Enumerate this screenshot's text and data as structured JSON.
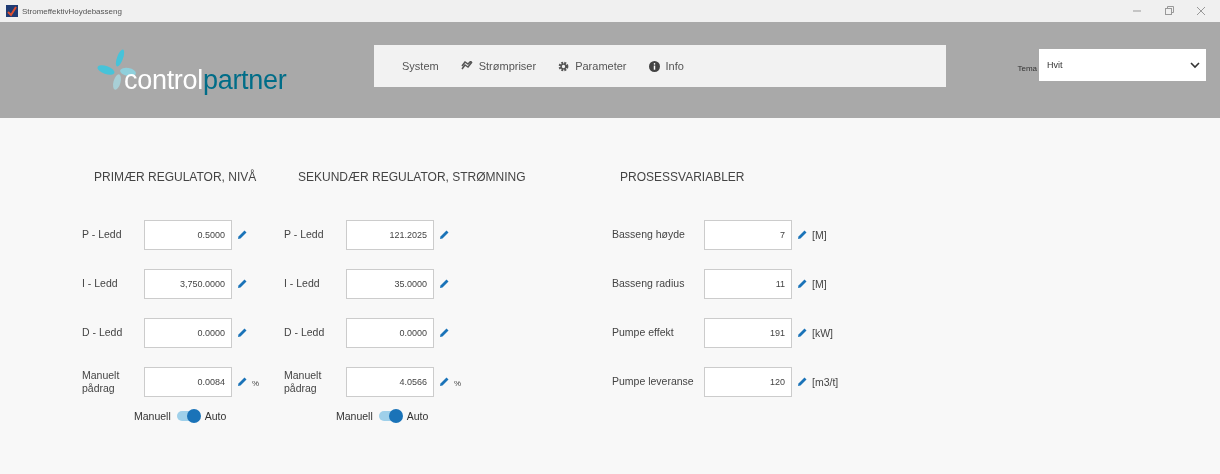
{
  "window": {
    "title": "StromeffektivHoydebasseng"
  },
  "logo": {
    "first": "control",
    "second": "partner"
  },
  "nav": [
    {
      "label": "System",
      "kind": "plain"
    },
    {
      "label": "Strømpriser",
      "kind": "chart"
    },
    {
      "label": "Parameter",
      "kind": "gear"
    },
    {
      "label": "Info",
      "kind": "info"
    }
  ],
  "theme": {
    "label": "Tema",
    "value": "Hvit"
  },
  "regulators": [
    {
      "title": "PRIMÆR REGULATOR, NIVÅ",
      "rows": [
        {
          "label": "P - Ledd",
          "value": "0.5000"
        },
        {
          "label": "I - Ledd",
          "value": "3,750.0000"
        },
        {
          "label": "D - Ledd",
          "value": "0.0000"
        },
        {
          "label": "Manuelt pådrag",
          "value": "0.0084",
          "unit": "%"
        }
      ],
      "toggle": {
        "off_label": "Manuell",
        "on_label": "Auto",
        "on": true
      }
    },
    {
      "title": "SEKUNDÆR REGULATOR, STRØMNING",
      "rows": [
        {
          "label": "P - Ledd",
          "value": "121.2025"
        },
        {
          "label": "I - Ledd",
          "value": "35.0000"
        },
        {
          "label": "D - Ledd",
          "value": "0.0000"
        },
        {
          "label": "Manuelt pådrag",
          "value": "4.0566",
          "unit": "%"
        }
      ],
      "toggle": {
        "off_label": "Manuell",
        "on_label": "Auto",
        "on": true
      }
    }
  ],
  "process": {
    "title": "PROSESSVARIABLER",
    "rows": [
      {
        "label": "Basseng høyde",
        "value": "7",
        "unit": "[M]"
      },
      {
        "label": "Basseng radius",
        "value": "11",
        "unit": "[M]"
      },
      {
        "label": "Pumpe effekt",
        "value": "191",
        "unit": "[kW]"
      },
      {
        "label": "Pumpe leveranse",
        "value": "120",
        "unit": "[m3/t]"
      }
    ]
  }
}
